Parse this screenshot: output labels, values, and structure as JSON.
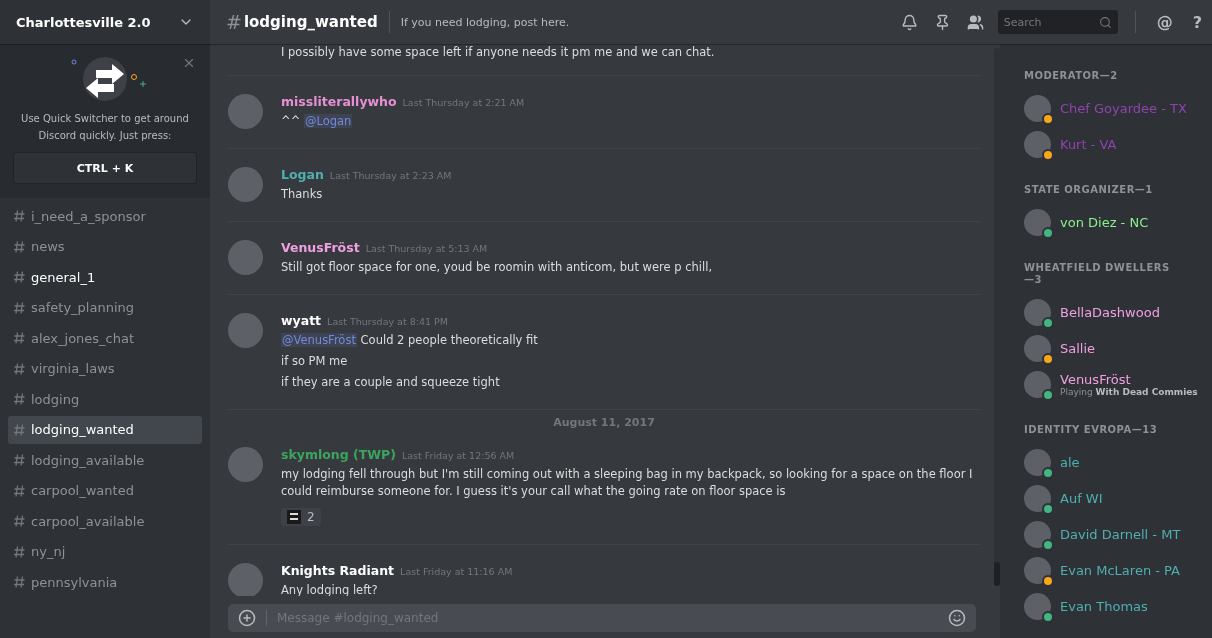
{
  "server": {
    "name": "Charlottesville 2.0"
  },
  "quick_switcher": {
    "text": "Use Quick Switcher to get around Discord quickly. Just press:",
    "shortcut": "CTRL + K"
  },
  "channels": [
    {
      "name": "i_need_a_sponsor",
      "selected": false,
      "unread": false
    },
    {
      "name": "news",
      "selected": false,
      "unread": false
    },
    {
      "name": "general_1",
      "selected": false,
      "unread": true
    },
    {
      "name": "safety_planning",
      "selected": false,
      "unread": false
    },
    {
      "name": "alex_jones_chat",
      "selected": false,
      "unread": false
    },
    {
      "name": "virginia_laws",
      "selected": false,
      "unread": false
    },
    {
      "name": "lodging",
      "selected": false,
      "unread": false
    },
    {
      "name": "lodging_wanted",
      "selected": true,
      "unread": false
    },
    {
      "name": "lodging_available",
      "selected": false,
      "unread": false
    },
    {
      "name": "carpool_wanted",
      "selected": false,
      "unread": false
    },
    {
      "name": "carpool_available",
      "selected": false,
      "unread": false
    },
    {
      "name": "ny_nj",
      "selected": false,
      "unread": false
    },
    {
      "name": "pennsylvania",
      "selected": false,
      "unread": false
    }
  ],
  "header": {
    "hash": "#",
    "channel": "lodging_wanted",
    "topic": "If you need lodging, post here.",
    "search_placeholder": "Search",
    "mentions": "@",
    "help": "?"
  },
  "messages": [
    {
      "kind": "continuation",
      "lines": [
        [
          {
            "kind": "text",
            "text": "I possibly have some space left if anyone needs it pm me and we can chat."
          }
        ]
      ]
    },
    {
      "kind": "message",
      "author": "missliterallywho",
      "color": "#e690d4",
      "time": "Last Thursday at 2:21 AM",
      "lines": [
        [
          {
            "kind": "text",
            "text": "^^"
          },
          {
            "kind": "mention",
            "text": "@Logan"
          }
        ]
      ]
    },
    {
      "kind": "message",
      "author": "Logan",
      "color": "#4fb0b0",
      "time": "Last Thursday at 2:23 AM",
      "lines": [
        [
          {
            "kind": "text",
            "text": "Thanks"
          }
        ]
      ]
    },
    {
      "kind": "message",
      "author": "VenusFröst",
      "color": "#f0a0e0",
      "time": "Last Thursday at 5:13 AM",
      "lines": [
        [
          {
            "kind": "text",
            "text": "Still got floor space for one, youd be roomin with anticom, but were p chill,"
          }
        ]
      ]
    },
    {
      "kind": "message",
      "author": "wyatt",
      "color": "#ffffff",
      "time": "Last Thursday at 8:41 PM",
      "lines": [
        [
          {
            "kind": "mention",
            "text": "@VenusFröst"
          },
          {
            "kind": "text",
            "text": "Could 2 people theoretically fit"
          }
        ],
        [
          {
            "kind": "text",
            "text": "if so PM me"
          }
        ],
        [
          {
            "kind": "text",
            "text": "if they are a couple and squeeze tight"
          }
        ]
      ]
    },
    {
      "kind": "divider",
      "text": "August 11, 2017"
    },
    {
      "kind": "message",
      "author": "skymlong (TWP)",
      "color": "#3aa55d",
      "time": "Last Friday at 12:56 AM",
      "lines": [
        [
          {
            "kind": "text",
            "text": "my lodging fell through but I'm still coming out with a sleeping bag in my backpack, so looking for a space on the floor I could reimburse someone for. I guess it's your call what the going rate on floor space is"
          }
        ]
      ],
      "reactions": [
        {
          "count": "2"
        }
      ]
    },
    {
      "kind": "message",
      "author": "Knights Radiant",
      "color": "#ffffff",
      "time": "Last Friday at 11:16 AM",
      "lines": [
        [
          {
            "kind": "text",
            "text": "Any lodging left?"
          }
        ]
      ]
    }
  ],
  "composer": {
    "placeholder": "Message #lodging_wanted"
  },
  "member_groups": [
    {
      "title": "MODERATOR—2",
      "color": "#8e44ad",
      "members": [
        {
          "name": "Chef Goyardee - TX",
          "color": "#faa61a"
        },
        {
          "name": "Kurt - VA",
          "color": "#faa61a"
        }
      ]
    },
    {
      "title": "STATE ORGANIZER—1",
      "color": "#8af28a",
      "members": [
        {
          "name": "von Diez - NC",
          "color": "#43b581"
        }
      ]
    },
    {
      "title": "WHEATFIELD DWELLERS—3",
      "color": "#f0a0e0",
      "members": [
        {
          "name": "BellaDashwood",
          "color": "#43b581"
        },
        {
          "name": "Sallie",
          "color": "#faa61a"
        },
        {
          "name": "VenusFröst",
          "color": "#43b581",
          "activity_prefix": "Playing",
          "activity": "With Dead Commies"
        }
      ]
    },
    {
      "title": "IDENTITY EVROPA—13",
      "color": "#4fb0b0",
      "members": [
        {
          "name": "ale",
          "color": "#43b581"
        },
        {
          "name": "Auf WI",
          "color": "#43b581"
        },
        {
          "name": "David Darnell - MT",
          "color": "#43b581"
        },
        {
          "name": "Evan McLaren - PA",
          "color": "#faa61a"
        },
        {
          "name": "Evan Thomas",
          "color": "#43b581"
        }
      ]
    }
  ]
}
